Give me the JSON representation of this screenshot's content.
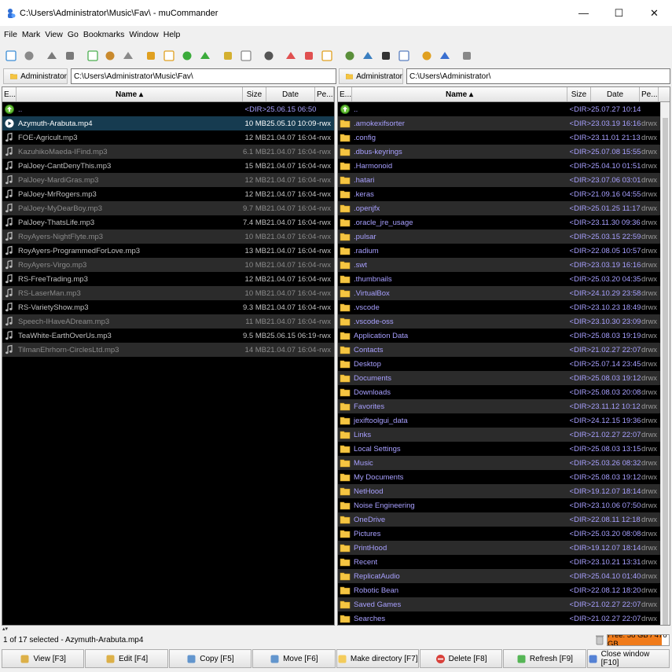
{
  "window": {
    "title": "C:\\Users\\Administrator\\Music\\Fav\\ - muCommander",
    "minimize": "—",
    "maximize": "☐",
    "close": "✕"
  },
  "menu": [
    "File",
    "Mark",
    "View",
    "Go",
    "Bookmarks",
    "Window",
    "Help"
  ],
  "left_pane": {
    "volume": "Administrator",
    "path": "C:\\Users\\Administrator\\Music\\Fav\\",
    "headers": {
      "ext": "E...",
      "name": "Name ▴",
      "size": "Size",
      "date": "Date",
      "perm": "Pe..."
    },
    "rows": [
      {
        "name": "..",
        "size": "<DIR>",
        "date": "25.06.15 06:50",
        "perm": "",
        "kind": "parent"
      },
      {
        "name": "Azymuth-Arabuta.mp4",
        "size": "10 MB",
        "date": "25.05.10 10:09",
        "perm": "-rwx",
        "kind": "selected"
      },
      {
        "name": "FOE-Agricult.mp3",
        "size": "12 MB",
        "date": "21.04.07 16:04",
        "perm": "-rwx",
        "kind": "file"
      },
      {
        "name": "KazuhikoMaeda-IFind.mp3",
        "size": "6.1 MB",
        "date": "21.04.07 16:04",
        "perm": "-rwx",
        "kind": "dim"
      },
      {
        "name": "PalJoey-CantDenyThis.mp3",
        "size": "15 MB",
        "date": "21.04.07 16:04",
        "perm": "-rwx",
        "kind": "file"
      },
      {
        "name": "PalJoey-MardiGras.mp3",
        "size": "12 MB",
        "date": "21.04.07 16:04",
        "perm": "-rwx",
        "kind": "dim"
      },
      {
        "name": "PalJoey-MrRogers.mp3",
        "size": "12 MB",
        "date": "21.04.07 16:04",
        "perm": "-rwx",
        "kind": "file"
      },
      {
        "name": "PalJoey-MyDearBoy.mp3",
        "size": "9.7 MB",
        "date": "21.04.07 16:04",
        "perm": "-rwx",
        "kind": "dim"
      },
      {
        "name": "PalJoey-ThatsLife.mp3",
        "size": "7.4 MB",
        "date": "21.04.07 16:04",
        "perm": "-rwx",
        "kind": "file"
      },
      {
        "name": "RoyAyers-NightFlyte.mp3",
        "size": "10 MB",
        "date": "21.04.07 16:04",
        "perm": "-rwx",
        "kind": "dim"
      },
      {
        "name": "RoyAyers-ProgrammedForLove.mp3",
        "size": "13 MB",
        "date": "21.04.07 16:04",
        "perm": "-rwx",
        "kind": "file"
      },
      {
        "name": "RoyAyers-Virgo.mp3",
        "size": "10 MB",
        "date": "21.04.07 16:04",
        "perm": "-rwx",
        "kind": "dim"
      },
      {
        "name": "RS-FreeTrading.mp3",
        "size": "12 MB",
        "date": "21.04.07 16:04",
        "perm": "-rwx",
        "kind": "file"
      },
      {
        "name": "RS-LaserMan.mp3",
        "size": "10 MB",
        "date": "21.04.07 16:04",
        "perm": "-rwx",
        "kind": "dim"
      },
      {
        "name": "RS-VarietyShow.mp3",
        "size": "9.3 MB",
        "date": "21.04.07 16:04",
        "perm": "-rwx",
        "kind": "file"
      },
      {
        "name": "Speech-IHaveADream.mp3",
        "size": "11 MB",
        "date": "21.04.07 16:04",
        "perm": "-rwx",
        "kind": "dim"
      },
      {
        "name": "TeaWhite-EarthOverUs.mp3",
        "size": "9.5 MB",
        "date": "25.06.15 06:19",
        "perm": "-rwx",
        "kind": "file"
      },
      {
        "name": "TilmanEhrhorn-CirclesLtd.mp3",
        "size": "14 MB",
        "date": "21.04.07 16:04",
        "perm": "-rwx",
        "kind": "dim"
      }
    ]
  },
  "right_pane": {
    "volume": "Administrator",
    "path": "C:\\Users\\Administrator\\",
    "headers": {
      "ext": "E...",
      "name": "Name ▴",
      "size": "Size",
      "date": "Date",
      "perm": "Pe..."
    },
    "rows": [
      {
        "name": "..",
        "size": "<DIR>",
        "date": "25.07.27 10:14",
        "perm": "",
        "kind": "parent"
      },
      {
        "name": ".amokexifsorter",
        "size": "<DIR>",
        "date": "23.03.19 16:16",
        "perm": "drwx",
        "kind": "dir"
      },
      {
        "name": ".config",
        "size": "<DIR>",
        "date": "23.11.01 21:13",
        "perm": "drwx",
        "kind": "dir"
      },
      {
        "name": ".dbus-keyrings",
        "size": "<DIR>",
        "date": "25.07.08 15:55",
        "perm": "drwx",
        "kind": "dir"
      },
      {
        "name": ".Harmonoid",
        "size": "<DIR>",
        "date": "25.04.10 01:51",
        "perm": "drwx",
        "kind": "dir"
      },
      {
        "name": ".hatari",
        "size": "<DIR>",
        "date": "23.07.06 03:01",
        "perm": "drwx",
        "kind": "dir"
      },
      {
        "name": ".keras",
        "size": "<DIR>",
        "date": "21.09.16 04:55",
        "perm": "drwx",
        "kind": "dir"
      },
      {
        "name": ".openjfx",
        "size": "<DIR>",
        "date": "25.01.25 11:17",
        "perm": "drwx",
        "kind": "dir"
      },
      {
        "name": ".oracle_jre_usage",
        "size": "<DIR>",
        "date": "23.11.30 09:36",
        "perm": "drwx",
        "kind": "dir"
      },
      {
        "name": ".pulsar",
        "size": "<DIR>",
        "date": "25.03.15 22:59",
        "perm": "drwx",
        "kind": "dir"
      },
      {
        "name": ".radium",
        "size": "<DIR>",
        "date": "22.08.05 10:57",
        "perm": "drwx",
        "kind": "dir"
      },
      {
        "name": ".swt",
        "size": "<DIR>",
        "date": "23.03.19 16:16",
        "perm": "drwx",
        "kind": "dir"
      },
      {
        "name": ".thumbnails",
        "size": "<DIR>",
        "date": "25.03.20 04:35",
        "perm": "drwx",
        "kind": "dir"
      },
      {
        "name": ".VirtualBox",
        "size": "<DIR>",
        "date": "24.10.29 23:58",
        "perm": "drwx",
        "kind": "dir"
      },
      {
        "name": ".vscode",
        "size": "<DIR>",
        "date": "23.10.23 18:49",
        "perm": "drwx",
        "kind": "dir"
      },
      {
        "name": ".vscode-oss",
        "size": "<DIR>",
        "date": "23.10.30 23:09",
        "perm": "drwx",
        "kind": "dir"
      },
      {
        "name": "Application Data",
        "size": "<DIR>",
        "date": "25.08.03 19:19",
        "perm": "drwx",
        "kind": "dir"
      },
      {
        "name": "Contacts",
        "size": "<DIR>",
        "date": "21.02.27 22:07",
        "perm": "drwx",
        "kind": "dir"
      },
      {
        "name": "Desktop",
        "size": "<DIR>",
        "date": "25.07.14 23:45",
        "perm": "drwx",
        "kind": "dir"
      },
      {
        "name": "Documents",
        "size": "<DIR>",
        "date": "25.08.03 19:12",
        "perm": "drwx",
        "kind": "dir"
      },
      {
        "name": "Downloads",
        "size": "<DIR>",
        "date": "25.08.03 20:08",
        "perm": "drwx",
        "kind": "dir"
      },
      {
        "name": "Favorites",
        "size": "<DIR>",
        "date": "23.11.12 10:12",
        "perm": "drwx",
        "kind": "dir"
      },
      {
        "name": "jexiftoolgui_data",
        "size": "<DIR>",
        "date": "24.12.15 19:36",
        "perm": "drwx",
        "kind": "dir"
      },
      {
        "name": "Links",
        "size": "<DIR>",
        "date": "21.02.27 22:07",
        "perm": "drwx",
        "kind": "dir"
      },
      {
        "name": "Local Settings",
        "size": "<DIR>",
        "date": "25.08.03 13:15",
        "perm": "drwx",
        "kind": "dir"
      },
      {
        "name": "Music",
        "size": "<DIR>",
        "date": "25.03.26 08:32",
        "perm": "drwx",
        "kind": "dir"
      },
      {
        "name": "My Documents",
        "size": "<DIR>",
        "date": "25.08.03 19:12",
        "perm": "drwx",
        "kind": "dir"
      },
      {
        "name": "NetHood",
        "size": "<DIR>",
        "date": "19.12.07 18:14",
        "perm": "drwx",
        "kind": "dir"
      },
      {
        "name": "Noise Engineering",
        "size": "<DIR>",
        "date": "23.10.06 07:50",
        "perm": "drwx",
        "kind": "dir"
      },
      {
        "name": "OneDrive",
        "size": "<DIR>",
        "date": "22.08.11 12:18",
        "perm": "drwx",
        "kind": "dir"
      },
      {
        "name": "Pictures",
        "size": "<DIR>",
        "date": "25.03.20 08:08",
        "perm": "drwx",
        "kind": "dir"
      },
      {
        "name": "PrintHood",
        "size": "<DIR>",
        "date": "19.12.07 18:14",
        "perm": "drwx",
        "kind": "dir"
      },
      {
        "name": "Recent",
        "size": "<DIR>",
        "date": "23.10.21 13:31",
        "perm": "drwx",
        "kind": "dir"
      },
      {
        "name": "ReplicatAudio",
        "size": "<DIR>",
        "date": "25.04.10 01:40",
        "perm": "drwx",
        "kind": "dir"
      },
      {
        "name": "Robotic Bean",
        "size": "<DIR>",
        "date": "22.08.12 18:20",
        "perm": "drwx",
        "kind": "dir"
      },
      {
        "name": "Saved Games",
        "size": "<DIR>",
        "date": "21.02.27 22:07",
        "perm": "drwx",
        "kind": "dir"
      },
      {
        "name": "Searches",
        "size": "<DIR>",
        "date": "21.02.27 22:07",
        "perm": "drwx",
        "kind": "dir"
      }
    ]
  },
  "status": {
    "text": "1 of 17 selected - Azymuth-Arabuta.mp4",
    "free_space": "Free: 58 GB / 476 GB",
    "used_fraction": 0.88
  },
  "commands": [
    {
      "label": "View [F3]",
      "icon": "magnifier-icon"
    },
    {
      "label": "Edit [F4]",
      "icon": "pencil-icon"
    },
    {
      "label": "Copy [F5]",
      "icon": "copy-icon"
    },
    {
      "label": "Move [F6]",
      "icon": "move-icon"
    },
    {
      "label": "Make directory [F7]",
      "icon": "new-folder-icon"
    },
    {
      "label": "Delete [F8]",
      "icon": "delete-icon"
    },
    {
      "label": "Refresh [F9]",
      "icon": "refresh-icon"
    },
    {
      "label": "Close window [F10]",
      "icon": "close-window-icon"
    }
  ],
  "toolbar_icons": [
    "new-window-icon",
    "new-tab-icon",
    "back-icon",
    "forward-icon",
    "parent-folder-icon",
    "home-icon",
    "stop-icon",
    "mark-icon",
    "unmark-icon",
    "swap-icon",
    "sync-icon",
    "pack-icon",
    "unpack-icon",
    "server-icon",
    "bookmark-add-icon",
    "bookmark-icon",
    "key-icon",
    "network-icon",
    "globe-icon",
    "terminal-icon",
    "email-icon",
    "run-icon",
    "info-icon",
    "settings-icon"
  ],
  "colors": {
    "selection": "#163b50",
    "dir_text": "#a8a0ff",
    "file_text": "#c0c0c0",
    "free_bar": "#f07b1a"
  }
}
